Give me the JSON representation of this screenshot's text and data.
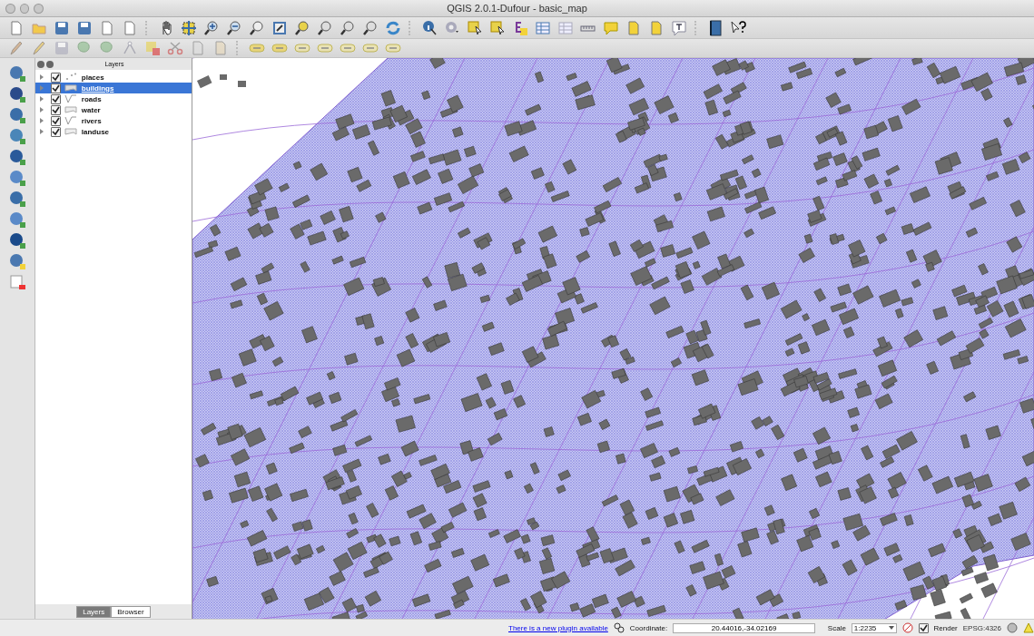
{
  "window": {
    "title": "QGIS 2.0.1-Dufour - basic_map"
  },
  "layers_panel": {
    "title": "Layers",
    "layers": [
      {
        "name": "places",
        "kind": "point",
        "checked": true,
        "selected": false
      },
      {
        "name": "buildings",
        "kind": "polygon",
        "checked": true,
        "selected": true
      },
      {
        "name": "roads",
        "kind": "line",
        "checked": true,
        "selected": false
      },
      {
        "name": "water",
        "kind": "polygon",
        "checked": true,
        "selected": false
      },
      {
        "name": "rivers",
        "kind": "line",
        "checked": true,
        "selected": false
      },
      {
        "name": "landuse",
        "kind": "polygon",
        "checked": true,
        "selected": false
      }
    ],
    "tabs": [
      {
        "label": "Layers",
        "selected": true
      },
      {
        "label": "Browser",
        "selected": false
      }
    ]
  },
  "status_bar": {
    "plugin_link": "There is a new plugin available",
    "coordinate_label": "Coordinate:",
    "coordinate": "20.44016,-34.02169",
    "scale_label": "Scale",
    "scale": "1:2235",
    "render_checked": true,
    "render_label": "Render",
    "crs": "EPSG:4326"
  }
}
